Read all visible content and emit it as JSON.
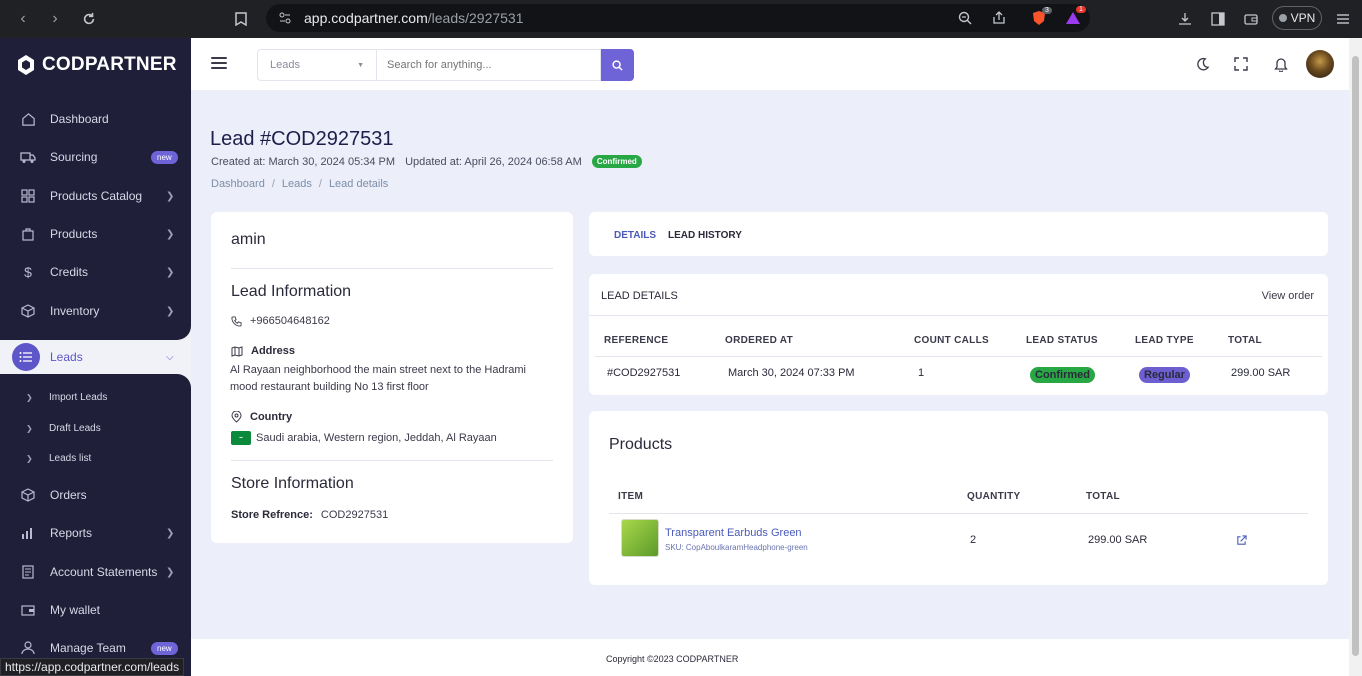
{
  "browser": {
    "url_host": "app.codpartner.com",
    "url_path": "/leads/2927531",
    "vpn_label": "VPN",
    "brave_badge": "3",
    "alert_badge": "1"
  },
  "sidebar": {
    "logo": "CODPARTNER",
    "items": [
      {
        "label": "Dashboard",
        "icon": "home-icon"
      },
      {
        "label": "Sourcing",
        "icon": "truck-icon",
        "badge": "new"
      },
      {
        "label": "Products Catalog",
        "icon": "grid-icon"
      },
      {
        "label": "Products",
        "icon": "bag-icon"
      },
      {
        "label": "Credits",
        "icon": "dollar-icon"
      },
      {
        "label": "Inventory",
        "icon": "box-icon"
      }
    ],
    "active": {
      "label": "Leads",
      "icon": "list-icon"
    },
    "sub_items": [
      "Import Leads",
      "Draft Leads",
      "Leads list"
    ],
    "items_bottom": [
      {
        "label": "Orders",
        "icon": "package-icon"
      },
      {
        "label": "Reports",
        "icon": "bar-chart-icon"
      },
      {
        "label": "Account Statements",
        "icon": "receipt-icon"
      },
      {
        "label": "My wallet",
        "icon": "wallet-icon"
      },
      {
        "label": "Manage Team",
        "icon": "user-icon",
        "badge": "new"
      }
    ]
  },
  "topbar": {
    "select_value": "Leads",
    "search_placeholder": "Search for anything..."
  },
  "page": {
    "title": "Lead #COD2927531",
    "created": "Created at: March 30, 2024 05:34 PM",
    "updated": "Updated at: April 26, 2024 06:58 AM",
    "status": "Confirmed",
    "breadcrumbs": [
      "Dashboard",
      "Leads",
      "Lead details"
    ]
  },
  "customer": {
    "name": "amin",
    "lead_info_title": "Lead Information",
    "phone": "+966504648162",
    "address_label": "Address",
    "address": "Al Rayaan neighborhood the main street next to the Hadrami mood restaurant building No 13 first floor",
    "country_label": "Country",
    "country": "Saudi arabia, Western region, Jeddah, Al Rayaan",
    "store_info_title": "Store Information",
    "store_ref_label": "Store Refrence:",
    "store_ref": "COD2927531"
  },
  "tabs": [
    "DETAILS",
    "LEAD HISTORY"
  ],
  "lead_details": {
    "title": "LEAD DETAILS",
    "view_order": "View order",
    "headers": [
      "REFERENCE",
      "ORDERED AT",
      "COUNT CALLS",
      "LEAD STATUS",
      "LEAD TYPE",
      "TOTAL"
    ],
    "row": {
      "reference": "#COD2927531",
      "ordered_at": "March 30, 2024 07:33 PM",
      "count_calls": "1",
      "lead_status": "Confirmed",
      "lead_type": "Regular",
      "total": "299.00 SAR"
    }
  },
  "products": {
    "title": "Products",
    "headers": [
      "ITEM",
      "QUANTITY",
      "TOTAL"
    ],
    "items": [
      {
        "name": "Transparent Earbuds Green",
        "sku": "SKU: CopAboulkaramHeadphone-green",
        "quantity": "2",
        "total": "299.00 SAR"
      }
    ]
  },
  "footer": {
    "copyright": "Copyright ©2023 CODPARTNER"
  },
  "status_url": "https://app.codpartner.com/leads",
  "colors": {
    "sidebar": "#1f1f3a",
    "accent": "#6e64d8",
    "confirmed": "#28a745",
    "regular": "#6e5fd0"
  }
}
